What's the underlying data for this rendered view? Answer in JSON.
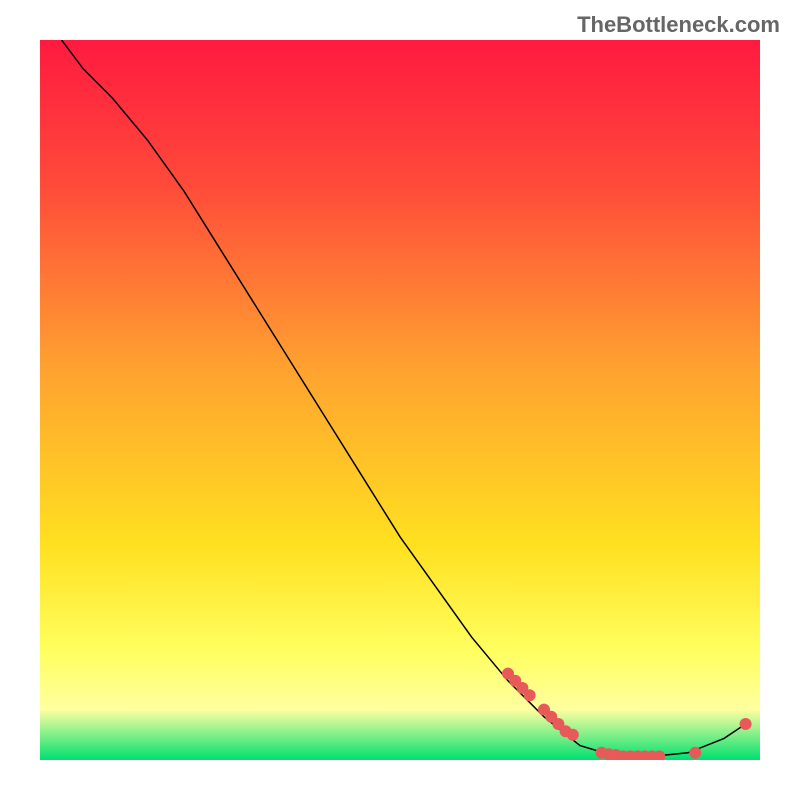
{
  "watermark": "TheBottleneck.com",
  "chart_data": {
    "type": "line",
    "title": "",
    "xlabel": "",
    "ylabel": "",
    "xlim": [
      0,
      100
    ],
    "ylim": [
      0,
      100
    ],
    "gradient_colors": {
      "top": "#ff1a40",
      "mid_upper": "#ff4a3a",
      "middle": "#ffa030",
      "mid_lower": "#ffe020",
      "lower": "#ffff60",
      "near_bottom": "#ffffa0",
      "bottom": "#00e070"
    },
    "curve": {
      "color": "#000000",
      "width": 1.5,
      "points": [
        {
          "x": 3,
          "y": 100
        },
        {
          "x": 6,
          "y": 96
        },
        {
          "x": 10,
          "y": 92
        },
        {
          "x": 15,
          "y": 86
        },
        {
          "x": 20,
          "y": 79
        },
        {
          "x": 25,
          "y": 71
        },
        {
          "x": 30,
          "y": 63
        },
        {
          "x": 35,
          "y": 55
        },
        {
          "x": 40,
          "y": 47
        },
        {
          "x": 45,
          "y": 39
        },
        {
          "x": 50,
          "y": 31
        },
        {
          "x": 55,
          "y": 24
        },
        {
          "x": 60,
          "y": 17
        },
        {
          "x": 65,
          "y": 11
        },
        {
          "x": 70,
          "y": 6
        },
        {
          "x": 75,
          "y": 2
        },
        {
          "x": 80,
          "y": 0.5
        },
        {
          "x": 85,
          "y": 0.5
        },
        {
          "x": 90,
          "y": 1
        },
        {
          "x": 95,
          "y": 3
        },
        {
          "x": 98,
          "y": 5
        }
      ]
    },
    "scatter_points": {
      "color": "#e85a5a",
      "radius": 6,
      "points": [
        {
          "x": 65,
          "y": 12
        },
        {
          "x": 66,
          "y": 11
        },
        {
          "x": 67,
          "y": 10
        },
        {
          "x": 68,
          "y": 9
        },
        {
          "x": 70,
          "y": 7
        },
        {
          "x": 71,
          "y": 6
        },
        {
          "x": 72,
          "y": 5
        },
        {
          "x": 73,
          "y": 4
        },
        {
          "x": 74,
          "y": 3.5
        },
        {
          "x": 78,
          "y": 1
        },
        {
          "x": 79,
          "y": 0.8
        },
        {
          "x": 80,
          "y": 0.7
        },
        {
          "x": 81,
          "y": 0.5
        },
        {
          "x": 82,
          "y": 0.5
        },
        {
          "x": 83,
          "y": 0.5
        },
        {
          "x": 84,
          "y": 0.5
        },
        {
          "x": 85,
          "y": 0.5
        },
        {
          "x": 86,
          "y": 0.5
        },
        {
          "x": 91,
          "y": 1
        },
        {
          "x": 98,
          "y": 5
        }
      ]
    }
  }
}
